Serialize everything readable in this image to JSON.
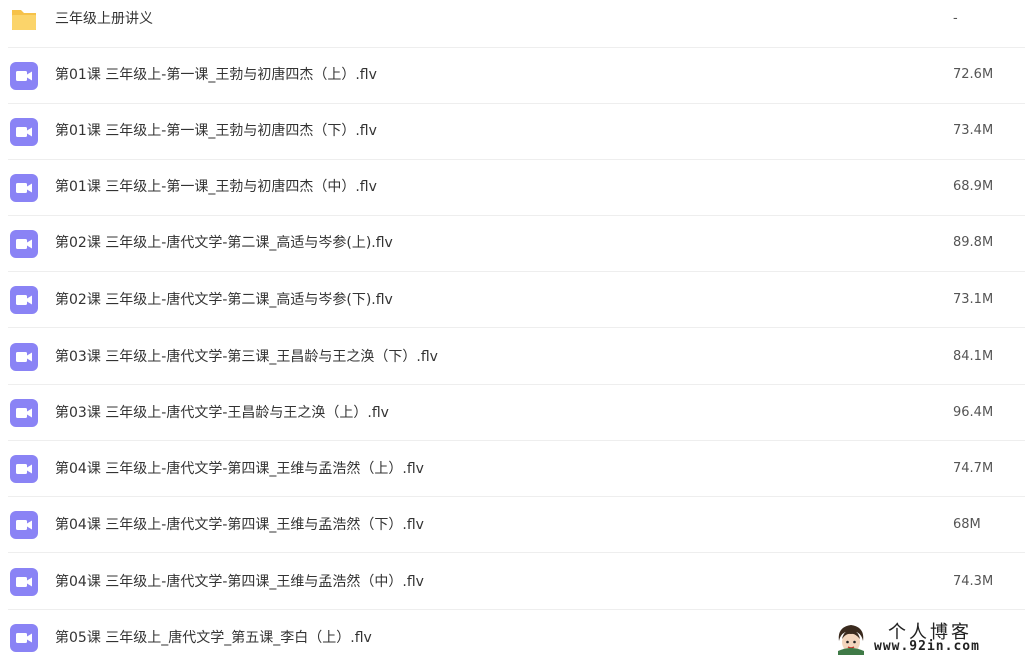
{
  "files": [
    {
      "type": "folder",
      "icon": "folder-icon",
      "name": "三年级上册讲义",
      "size": "-"
    },
    {
      "type": "video",
      "icon": "video-icon",
      "name": "第01课 三年级上-第一课_王勃与初唐四杰（上）.flv",
      "size": "72.6M"
    },
    {
      "type": "video",
      "icon": "video-icon",
      "name": "第01课 三年级上-第一课_王勃与初唐四杰（下）.flv",
      "size": "73.4M"
    },
    {
      "type": "video",
      "icon": "video-icon",
      "name": "第01课 三年级上-第一课_王勃与初唐四杰（中）.flv",
      "size": "68.9M"
    },
    {
      "type": "video",
      "icon": "video-icon",
      "name": "第02课 三年级上-唐代文学-第二课_高适与岑参(上).flv",
      "size": "89.8M"
    },
    {
      "type": "video",
      "icon": "video-icon",
      "name": "第02课 三年级上-唐代文学-第二课_高适与岑参(下).flv",
      "size": "73.1M"
    },
    {
      "type": "video",
      "icon": "video-icon",
      "name": "第03课 三年级上-唐代文学-第三课_王昌龄与王之涣（下）.flv",
      "size": "84.1M"
    },
    {
      "type": "video",
      "icon": "video-icon",
      "name": "第03课 三年级上-唐代文学-王昌龄与王之涣（上）.flv",
      "size": "96.4M"
    },
    {
      "type": "video",
      "icon": "video-icon",
      "name": "第04课 三年级上-唐代文学-第四课_王维与孟浩然（上）.flv",
      "size": "74.7M"
    },
    {
      "type": "video",
      "icon": "video-icon",
      "name": "第04课 三年级上-唐代文学-第四课_王维与孟浩然（下）.flv",
      "size": "68M"
    },
    {
      "type": "video",
      "icon": "video-icon",
      "name": "第04课 三年级上-唐代文学-第四课_王维与孟浩然（中）.flv",
      "size": "74.3M"
    },
    {
      "type": "video",
      "icon": "video-icon",
      "name": "第05课 三年级上_唐代文学_第五课_李白（上）.flv",
      "size": ""
    }
  ],
  "watermark": {
    "brand": "个人博客",
    "url": "www.92in.com"
  },
  "colors": {
    "folder": "#f9cc5b",
    "video": "#8a83f5",
    "separator": "#eeeeee",
    "text": "#333333"
  }
}
